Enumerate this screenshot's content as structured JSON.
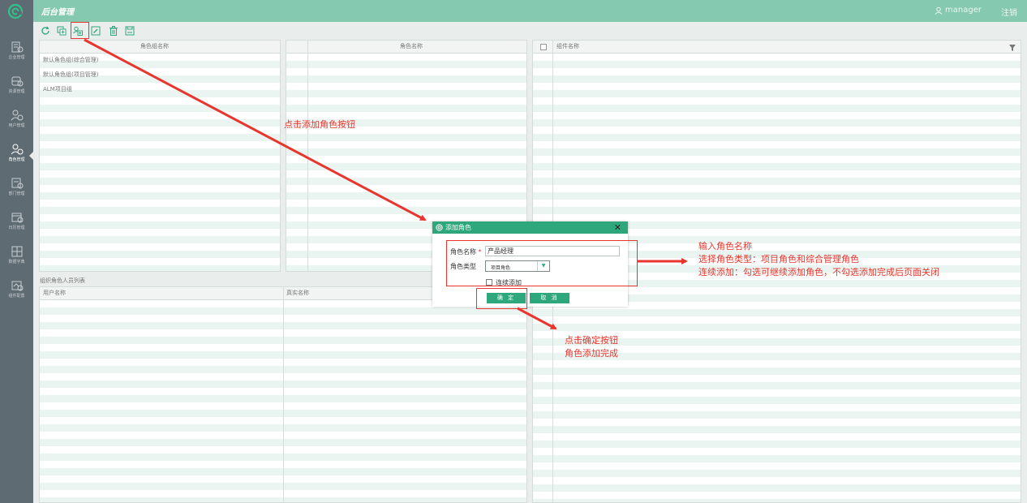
{
  "app": {
    "title": "后台管理",
    "username": "manager",
    "logout_label": "注销"
  },
  "sidebar": {
    "items": [
      {
        "label": "企业管理",
        "icon": "enterprise-icon"
      },
      {
        "label": "资源管理",
        "icon": "resource-icon"
      },
      {
        "label": "用户管理",
        "icon": "users-icon"
      },
      {
        "label": "角色管理",
        "icon": "roles-icon",
        "active": true
      },
      {
        "label": "部门管理",
        "icon": "department-icon"
      },
      {
        "label": "日历管理",
        "icon": "calendar-icon"
      },
      {
        "label": "数据字典",
        "icon": "dictionary-icon"
      },
      {
        "label": "组件配置",
        "icon": "component-config-icon"
      }
    ]
  },
  "toolbar": {
    "buttons": [
      {
        "name": "refresh",
        "icon": "refresh-icon"
      },
      {
        "name": "add-group",
        "icon": "add-group-icon"
      },
      {
        "name": "add-role",
        "icon": "add-role-icon"
      },
      {
        "name": "edit",
        "icon": "edit-icon"
      },
      {
        "name": "delete",
        "icon": "delete-icon"
      },
      {
        "name": "save",
        "icon": "save-icon"
      }
    ]
  },
  "panels": {
    "role_groups": {
      "header": "角色组名称",
      "rows": [
        "默认角色组(综合管理)",
        "默认角色组(项目管理)",
        "ALM项目组"
      ]
    },
    "roles": {
      "header": "角色名称"
    },
    "components": {
      "header": "组件名称",
      "filter_icon": "filter-icon"
    },
    "members": {
      "section_label": "组织角色人员列表",
      "columns": [
        "用户名称",
        "真实名称"
      ]
    }
  },
  "dialog": {
    "title": "添加角色",
    "role_name_label": "角色名称",
    "role_name_value": "产品经理",
    "role_type_label": "角色类型",
    "role_type_value": "项目角色",
    "continuous_label": "连续添加",
    "continuous_checked": false,
    "ok_label": "确  定",
    "cancel_label": "取  消"
  },
  "annotations": {
    "click_add": "点击添加角色按钮",
    "input_line1": "输入角色名称",
    "input_line2": "选择角色类型：项目角色和综合管理角色",
    "input_line3": "连续添加：勾选可继续添加角色，不勾选添加完成后页面关闭",
    "confirm_line1": "点击确定按钮",
    "confirm_line2": "角色添加完成",
    "accent_color": "#e8362e"
  },
  "colors": {
    "header": "#86c9b1",
    "sidebar": "#5f6b72",
    "primary": "#2ea77d",
    "stripe": "#eaf4f1"
  }
}
